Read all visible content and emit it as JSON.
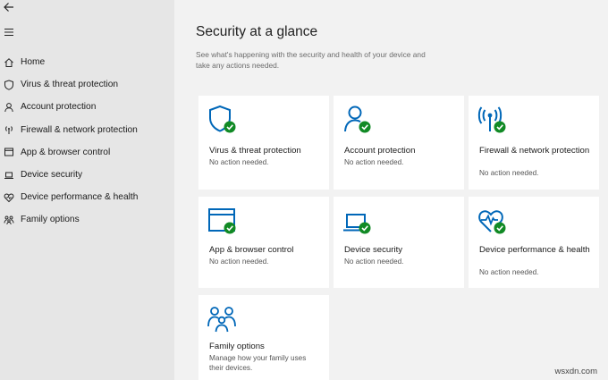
{
  "colors": {
    "accent": "#0067b8",
    "success": "#118a25",
    "sidebar_bg": "#e6e6e6",
    "main_bg": "#f2f2f2",
    "tile_bg": "#ffffff"
  },
  "sidebar": {
    "back_icon": "arrow-left-icon",
    "menu_icon": "hamburger-menu-icon",
    "items": [
      {
        "label": "Home",
        "icon": "home-icon"
      },
      {
        "label": "Virus & threat protection",
        "icon": "shield-icon"
      },
      {
        "label": "Account protection",
        "icon": "person-icon"
      },
      {
        "label": "Firewall & network protection",
        "icon": "antenna-icon"
      },
      {
        "label": "App & browser control",
        "icon": "window-icon"
      },
      {
        "label": "Device security",
        "icon": "laptop-icon"
      },
      {
        "label": "Device performance & health",
        "icon": "heart-icon"
      },
      {
        "label": "Family options",
        "icon": "family-icon"
      }
    ]
  },
  "main": {
    "title": "Security at a glance",
    "subtitle": "See what's happening with the security and health of your device and take any actions needed.",
    "tiles": [
      {
        "title": "Virus & threat protection",
        "status": "No action needed.",
        "icon": "shield-check-icon"
      },
      {
        "title": "Account protection",
        "status": "No action needed.",
        "icon": "person-check-icon"
      },
      {
        "title": "Firewall & network protection",
        "status": "No action needed.",
        "icon": "antenna-check-icon"
      },
      {
        "title": "App & browser control",
        "status": "No action needed.",
        "icon": "window-check-icon"
      },
      {
        "title": "Device security",
        "status": "No action needed.",
        "icon": "laptop-check-icon"
      },
      {
        "title": "Device performance & health",
        "status": "No action needed.",
        "icon": "heart-pulse-check-icon"
      },
      {
        "title": "Family options",
        "status": "Manage how your family uses their devices.",
        "icon": "family-icon"
      }
    ]
  },
  "watermark": "wsxdn.com"
}
